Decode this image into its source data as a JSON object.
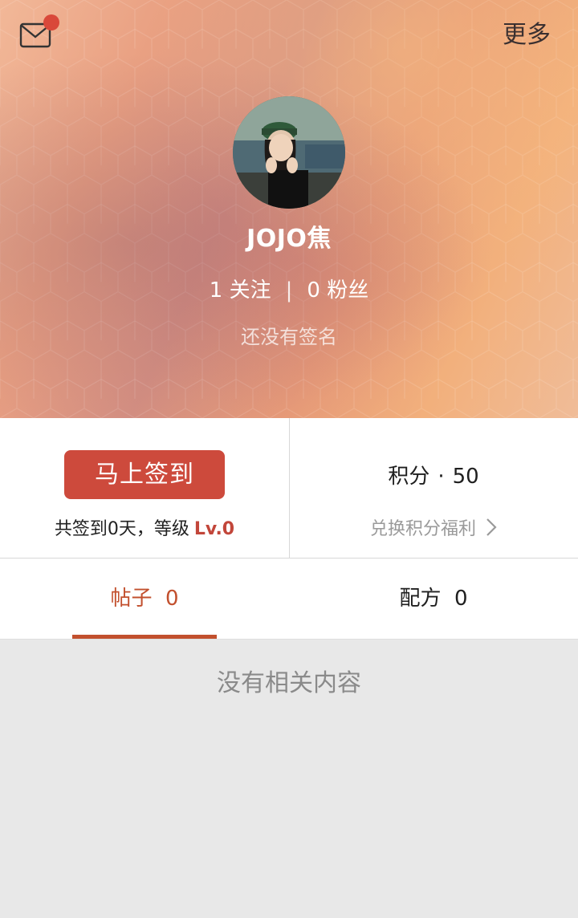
{
  "header": {
    "more_label": "更多",
    "username": "JOJO焦",
    "following_count": "1",
    "following_label": "关注",
    "stats_separator": "|",
    "followers_count": "0",
    "followers_label": "粉丝",
    "signature": "还没有签名",
    "mail_icon": "mail-icon",
    "has_unread_badge": true
  },
  "checkin": {
    "button_label": "马上签到",
    "summary_text": "共签到0天，等级",
    "level": "Lv.0"
  },
  "points": {
    "label": "积分",
    "separator": "·",
    "value": "50",
    "redeem_label": "兑换积分福利"
  },
  "tabs": [
    {
      "label": "帖子",
      "count": "0",
      "active": true
    },
    {
      "label": "配方",
      "count": "0",
      "active": false
    }
  ],
  "content": {
    "empty_message": "没有相关内容"
  },
  "colors": {
    "accent": "#c2502e",
    "button": "#cd4a3c",
    "badge": "#d9483a"
  }
}
